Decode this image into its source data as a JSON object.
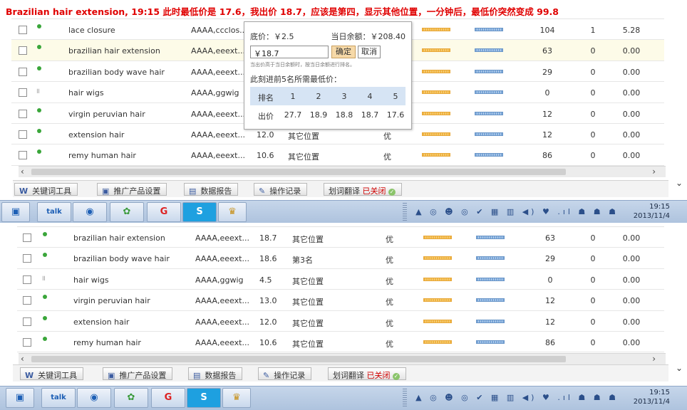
{
  "headline": "Brazilian hair extension, 19:15 此时最低价是 17.6，我出价 18.7，应该是第四，显示其他位置，一分钟后，最低价突然变成 99.8",
  "colors": {
    "headline": "#e00000",
    "status_dot": "#3aa63a",
    "closed": "#d00000"
  },
  "panel1": {
    "rows": [
      {
        "status": "active",
        "keyword": "lace closure",
        "match": "AAAA,ccclos...",
        "bid": "",
        "rank": "",
        "quality": "",
        "v1": "104",
        "v2": "1",
        "v3": "5.28"
      },
      {
        "status": "active",
        "keyword": "brazilian hair extension",
        "match": "AAAA,eeext...",
        "bid": "",
        "rank": "",
        "quality": "",
        "v1": "63",
        "v2": "0",
        "v3": "0.00"
      },
      {
        "status": "active",
        "keyword": "brazilian body wave hair",
        "match": "AAAA,eeext...",
        "bid": "",
        "rank": "",
        "quality": "",
        "v1": "29",
        "v2": "0",
        "v3": "0.00"
      },
      {
        "status": "paused",
        "keyword": "hair wigs",
        "match": "AAAA,ggwig",
        "bid": "",
        "rank": "",
        "quality": "",
        "v1": "0",
        "v2": "0",
        "v3": "0.00"
      },
      {
        "status": "active",
        "keyword": "virgin peruvian hair",
        "match": "AAAA,eeext...",
        "bid": "",
        "rank": "",
        "quality": "",
        "v1": "12",
        "v2": "0",
        "v3": "0.00"
      },
      {
        "status": "active",
        "keyword": "extension hair",
        "match": "AAAA,eeext...",
        "bid": "12.0",
        "rank": "其它位置",
        "quality": "优",
        "v1": "12",
        "v2": "0",
        "v3": "0.00"
      },
      {
        "status": "active",
        "keyword": "remy human hair",
        "match": "AAAA,eeext...",
        "bid": "10.6",
        "rank": "其它位置",
        "quality": "优",
        "v1": "86",
        "v2": "0",
        "v3": "0.00"
      }
    ]
  },
  "popup": {
    "floor_label": "底价：￥2.5",
    "balance_label": "当日余额：￥208.40",
    "bid_value": "￥18.7",
    "ok_label": "确定",
    "cancel_label": "取消",
    "tip": "当出价高于当日余额时，按当日余额进行排名。",
    "top5_label": "此刻进前5名所需最低价：",
    "rank_header": "排名",
    "price_header": "出价",
    "ranks": [
      "1",
      "2",
      "3",
      "4",
      "5"
    ],
    "prices": [
      "27.7",
      "18.9",
      "18.8",
      "18.7",
      "17.6"
    ]
  },
  "panel2": {
    "rows": [
      {
        "status": "active",
        "keyword": "brazilian hair extension",
        "match": "AAAA,eeext...",
        "bid": "18.7",
        "rank": "其它位置",
        "quality": "优",
        "v1": "63",
        "v2": "0",
        "v3": "0.00"
      },
      {
        "status": "active",
        "keyword": "brazilian body wave hair",
        "match": "AAAA,eeext...",
        "bid": "18.6",
        "rank": "第3名",
        "quality": "优",
        "v1": "29",
        "v2": "0",
        "v3": "0.00"
      },
      {
        "status": "paused",
        "keyword": "hair wigs",
        "match": "AAAA,ggwig",
        "bid": "4.5",
        "rank": "其它位置",
        "quality": "优",
        "v1": "0",
        "v2": "0",
        "v3": "0.00"
      },
      {
        "status": "active",
        "keyword": "virgin peruvian hair",
        "match": "AAAA,eeext...",
        "bid": "13.0",
        "rank": "其它位置",
        "quality": "优",
        "v1": "12",
        "v2": "0",
        "v3": "0.00"
      },
      {
        "status": "active",
        "keyword": "extension hair",
        "match": "AAAA,eeext...",
        "bid": "12.0",
        "rank": "其它位置",
        "quality": "优",
        "v1": "12",
        "v2": "0",
        "v3": "0.00"
      },
      {
        "status": "active",
        "keyword": "remy human hair",
        "match": "AAAA,eeext...",
        "bid": "10.6",
        "rank": "其它位置",
        "quality": "优",
        "v1": "86",
        "v2": "0",
        "v3": "0.00"
      }
    ]
  },
  "toolbar": {
    "keyword_tool": "关键词工具",
    "product_settings": "推广产品设置",
    "data_report": "数据报告",
    "operation_log": "操作记录",
    "translate": "划词翻译",
    "translate_state": "已关闭"
  },
  "taskbar": {
    "apps": [
      "app-icon",
      "talk-icon",
      "messenger-icon",
      "qq-group-icon",
      "red-g-icon",
      "skype-icon",
      "buddha-icon"
    ],
    "talk_label": "talk",
    "skype_label": "S",
    "time": "19:15",
    "date": "2013/11/4"
  }
}
